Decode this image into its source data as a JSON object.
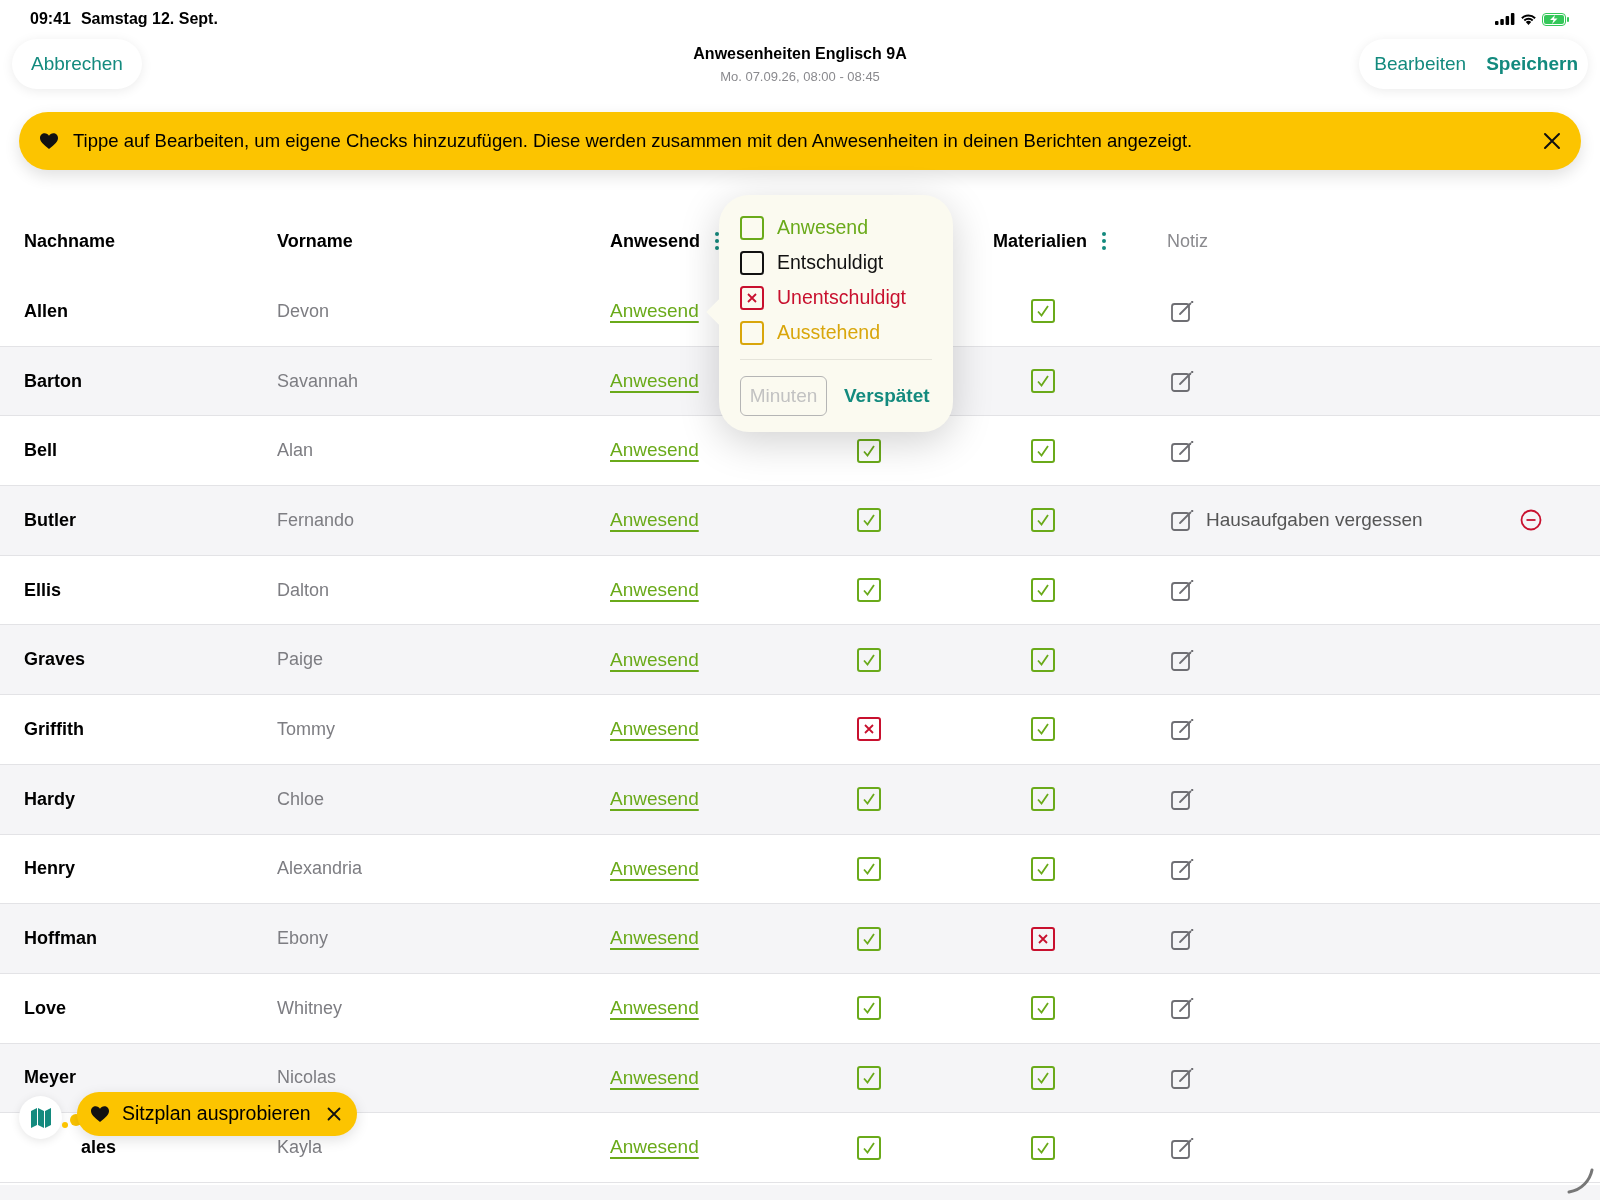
{
  "status_bar": {
    "time": "09:41",
    "date": "Samstag 12. Sept."
  },
  "nav": {
    "cancel": "Abbrechen",
    "title": "Anwesenheiten Englisch 9A",
    "subtitle": "Mo. 07.09.26, 08:00 - 08:45",
    "edit": "Bearbeiten",
    "save": "Speichern"
  },
  "banner": {
    "text": "Tippe auf Bearbeiten, um eigene Checks hinzuzufügen. Diese werden zusammen mit den Anwesenheiten in deinen Berichten angezeigt."
  },
  "table": {
    "headers": [
      {
        "label": "Nachname",
        "kind": "plain"
      },
      {
        "label": "Vorname",
        "kind": "plain"
      },
      {
        "label": "Anwesend",
        "kind": "menu"
      },
      {
        "label": "Materialien",
        "kind": "menu"
      },
      {
        "label": "Notiz",
        "kind": "muted"
      }
    ],
    "rows": [
      {
        "last_name": "Allen",
        "first_name": "Devon",
        "status": "Anwesend",
        "check_2": true
      },
      {
        "last_name": "Barton",
        "first_name": "Savannah",
        "status": "Anwesend",
        "check_2": true
      },
      {
        "last_name": "Bell",
        "first_name": "Alan",
        "status": "Anwesend",
        "check_1": true,
        "check_2": true
      },
      {
        "last_name": "Butler",
        "first_name": "Fernando",
        "status": "Anwesend",
        "check_1": true,
        "check_2": true,
        "note": "Hausaufgaben vergessen"
      },
      {
        "last_name": "Ellis",
        "first_name": "Dalton",
        "status": "Anwesend",
        "check_1": true,
        "check_2": true
      },
      {
        "last_name": "Graves",
        "first_name": "Paige",
        "status": "Anwesend",
        "check_1": true,
        "check_2": true
      },
      {
        "last_name": "Griffith",
        "first_name": "Tommy",
        "status": "Anwesend",
        "check_1": false,
        "check_2": true
      },
      {
        "last_name": "Hardy",
        "first_name": "Chloe",
        "status": "Anwesend",
        "check_1": true,
        "check_2": true
      },
      {
        "last_name": "Henry",
        "first_name": "Alexandria",
        "status": "Anwesend",
        "check_1": true,
        "check_2": true
      },
      {
        "last_name": "Hoffman",
        "first_name": "Ebony",
        "status": "Anwesend",
        "check_1": true,
        "check_2": false
      },
      {
        "last_name": "Love",
        "first_name": "Whitney",
        "status": "Anwesend",
        "check_1": true,
        "check_2": true
      },
      {
        "last_name": "Meyer",
        "first_name": "Nicolas",
        "status": "Anwesend",
        "check_1": true,
        "check_2": true
      },
      {
        "last_name": "ales",
        "first_name": "Kayla",
        "status": "Anwesend",
        "check_1": true,
        "check_2": true
      }
    ]
  },
  "popover": {
    "options": [
      {
        "label": "Anwesend",
        "kind": "present",
        "checked": false
      },
      {
        "label": "Entschuldigt",
        "kind": "excused",
        "checked": false
      },
      {
        "label": "Unentschuldigt",
        "kind": "unexcused",
        "checked": true
      },
      {
        "label": "Ausstehend",
        "kind": "pending",
        "checked": false
      }
    ],
    "minutes_placeholder": "Minuten",
    "late_button": "Verspätet"
  },
  "toast": {
    "text": "Sitzplan ausprobieren"
  }
}
